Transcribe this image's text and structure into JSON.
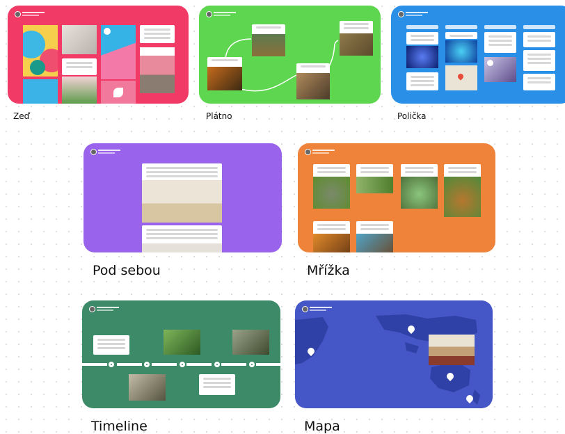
{
  "layouts": [
    {
      "id": "wall",
      "label": "Zeď",
      "color": "#f23a67"
    },
    {
      "id": "canvas",
      "label": "Plátno",
      "color": "#5fd64f"
    },
    {
      "id": "shelf",
      "label": "Polička",
      "color": "#2a8fe6"
    },
    {
      "id": "stream",
      "label": "Pod sebou",
      "color": "#9a63ec"
    },
    {
      "id": "grid",
      "label": "Mřížka",
      "color": "#ef8339"
    },
    {
      "id": "timeline",
      "label": "Timeline",
      "color": "#3d8a68"
    },
    {
      "id": "map",
      "label": "Mapa",
      "color": "#4556c6"
    }
  ],
  "icons": {
    "play": "play-icon",
    "pin": "map-pin-icon",
    "avatar": "avatar-icon"
  }
}
